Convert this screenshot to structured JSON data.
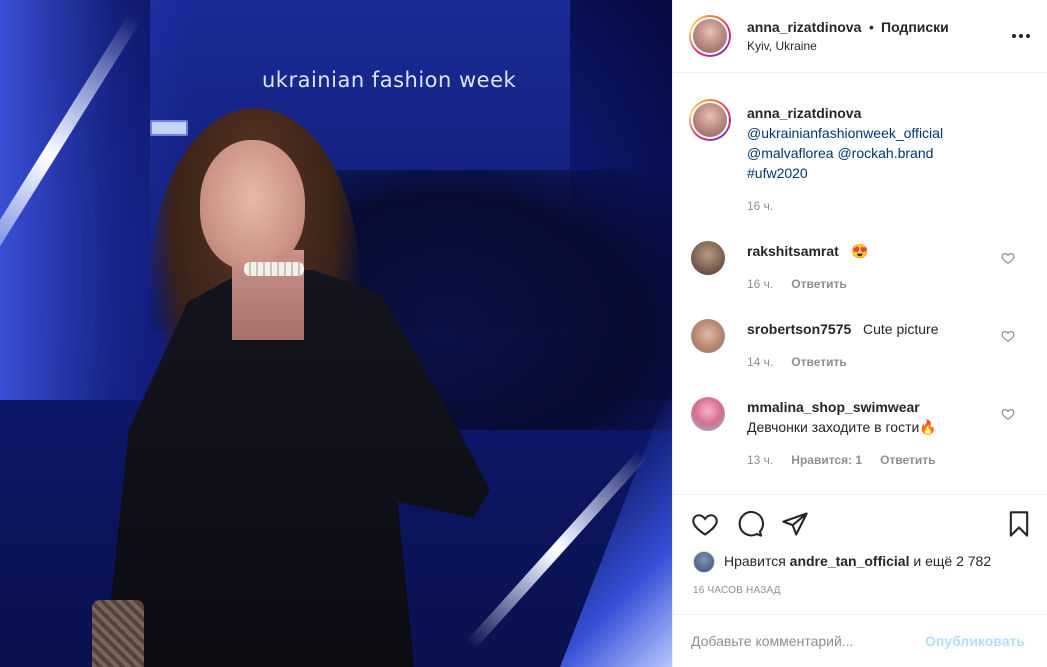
{
  "photo": {
    "sign_text": "ukrainian fashion week"
  },
  "header": {
    "username": "anna_rizatdinova",
    "separator": "•",
    "follow_label": "Подписки",
    "location": "Kyiv, Ukraine",
    "more_icon": "more-horizontal-icon"
  },
  "caption": {
    "username": "anna_rizatdinova",
    "lines": [
      "@ukrainianfashionweek_official",
      "@malvaflorea @rockah.brand",
      "#ufw2020"
    ],
    "time": "16 ч."
  },
  "comments": [
    {
      "username": "rakshitsamrat",
      "text": "😍",
      "time": "16 ч.",
      "likes": "",
      "reply": "Ответить"
    },
    {
      "username": "srobertson7575",
      "text": "Cute picture",
      "time": "14 ч.",
      "likes": "",
      "reply": "Ответить"
    },
    {
      "username": "mmalina_shop_swimwear",
      "text": "Девчонки заходите в гости🔥",
      "time": "13 ч.",
      "likes": "Нравится: 1",
      "reply": "Ответить"
    }
  ],
  "actions": {
    "like_icon": "heart-icon",
    "comment_icon": "comment-icon",
    "share_icon": "paper-plane-icon",
    "save_icon": "bookmark-icon",
    "likes_prefix": "Нравится",
    "likes_user": "andre_tan_official",
    "likes_suffix": "и ещё 2 782",
    "post_time": "16 ЧАСОВ НАЗАД"
  },
  "comment_box": {
    "placeholder": "Добавьте комментарий...",
    "publish_label": "Опубликовать"
  }
}
